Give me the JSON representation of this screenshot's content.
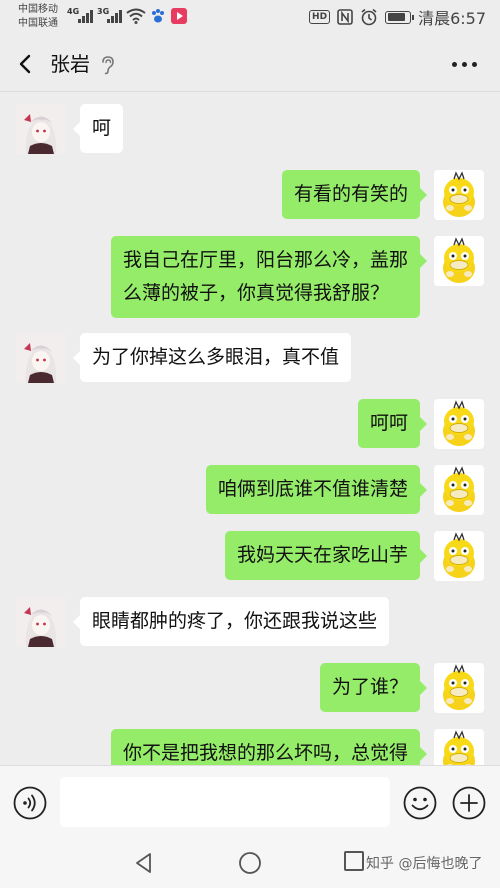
{
  "status_bar": {
    "carrier_1": "中国移动",
    "carrier_2": "中国联通",
    "net_1": "4G",
    "net_2": "3G",
    "hd": "HD",
    "time": "清晨6:57",
    "battery_level": 0.85
  },
  "header": {
    "title": "张岩"
  },
  "messages": [
    {
      "side": "left",
      "text": "呵"
    },
    {
      "side": "right",
      "text": "有看的有笑的"
    },
    {
      "side": "right",
      "text": "我自己在厅里，阳台那么冷，盖那\n么薄的被子，你真觉得我舒服？"
    },
    {
      "side": "left",
      "text": "为了你掉这么多眼泪，真不值"
    },
    {
      "side": "right",
      "text": "呵呵"
    },
    {
      "side": "right",
      "text": "咱俩到底谁不值谁清楚"
    },
    {
      "side": "right",
      "text": "我妈天天在家吃山芋"
    },
    {
      "side": "left",
      "text": "眼睛都肿的疼了，你还跟我说这些"
    },
    {
      "side": "right",
      "text": "为了谁？"
    },
    {
      "side": "right",
      "text": "你不是把我想的那么坏吗，总觉得"
    }
  ],
  "input": {
    "value": "",
    "placeholder": ""
  },
  "watermark": "知乎 @后悔也晚了",
  "colors": {
    "background": "#ededed",
    "bubble_self": "#95ec69",
    "bubble_other": "#ffffff"
  }
}
